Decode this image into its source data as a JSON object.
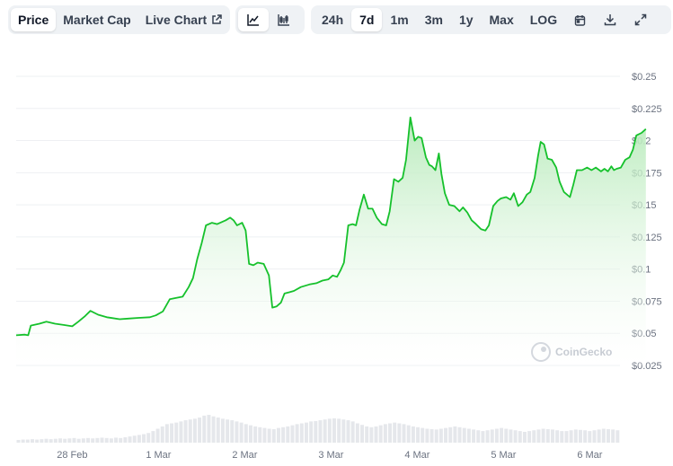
{
  "toolbar": {
    "view_tabs": [
      {
        "label": "Price",
        "active": true
      },
      {
        "label": "Market Cap",
        "active": false
      },
      {
        "label": "Live Chart",
        "active": false
      }
    ],
    "chart_types": [
      {
        "icon": "line-chart-icon",
        "active": true
      },
      {
        "icon": "candlestick-chart-icon",
        "active": false
      }
    ],
    "ranges": [
      {
        "label": "24h",
        "active": false
      },
      {
        "label": "7d",
        "active": true
      },
      {
        "label": "1m",
        "active": false
      },
      {
        "label": "3m",
        "active": false
      },
      {
        "label": "1y",
        "active": false
      },
      {
        "label": "Max",
        "active": false
      },
      {
        "label": "LOG",
        "active": false
      }
    ],
    "actions": [
      "calendar-icon",
      "download-icon",
      "expand-icon"
    ]
  },
  "watermark": "CoinGecko",
  "colors": {
    "line": "#16c12c",
    "fill_top": "#b6eab9",
    "volume": "#e5e7eb",
    "grid": "#eef0f3",
    "active_bg": "#ffffff",
    "segment_bg": "#eff2f5"
  },
  "chart_data": {
    "type": "area",
    "title": "",
    "xlabel": "",
    "ylabel": "",
    "x_range": [
      0,
      7
    ],
    "ylim": [
      0.025,
      0.25
    ],
    "y_ticks": [
      {
        "value": 0.25,
        "label": "$0.25"
      },
      {
        "value": 0.225,
        "label": "$0.225"
      },
      {
        "value": 0.2,
        "label": "$0.2"
      },
      {
        "value": 0.175,
        "label": "$0.175"
      },
      {
        "value": 0.15,
        "label": "$0.15"
      },
      {
        "value": 0.125,
        "label": "$0.125"
      },
      {
        "value": 0.1,
        "label": "$0.1"
      },
      {
        "value": 0.075,
        "label": "$0.075"
      },
      {
        "value": 0.05,
        "label": "$0.05"
      },
      {
        "value": 0.025,
        "label": "$0.025"
      }
    ],
    "x_ticks": [
      {
        "value": 0.65,
        "label": "28 Feb"
      },
      {
        "value": 1.65,
        "label": "1 Mar"
      },
      {
        "value": 2.65,
        "label": "2 Mar"
      },
      {
        "value": 3.65,
        "label": "3 Mar"
      },
      {
        "value": 4.65,
        "label": "4 Mar"
      },
      {
        "value": 5.65,
        "label": "5 Mar"
      },
      {
        "value": 6.65,
        "label": "6 Mar"
      }
    ],
    "grid": true,
    "series": [
      {
        "values": [
          [
            0.0,
            0.0485
          ],
          [
            0.1,
            0.049
          ],
          [
            0.14,
            0.0485
          ],
          [
            0.17,
            0.056
          ],
          [
            0.27,
            0.0575
          ],
          [
            0.35,
            0.059
          ],
          [
            0.45,
            0.0575
          ],
          [
            0.55,
            0.0565
          ],
          [
            0.65,
            0.0555
          ],
          [
            0.72,
            0.059
          ],
          [
            0.8,
            0.0635
          ],
          [
            0.86,
            0.0675
          ],
          [
            0.95,
            0.0645
          ],
          [
            1.05,
            0.0625
          ],
          [
            1.2,
            0.061
          ],
          [
            1.3,
            0.0615
          ],
          [
            1.42,
            0.062
          ],
          [
            1.55,
            0.0625
          ],
          [
            1.62,
            0.064
          ],
          [
            1.7,
            0.067
          ],
          [
            1.78,
            0.0765
          ],
          [
            1.85,
            0.0775
          ],
          [
            1.93,
            0.0785
          ],
          [
            2.0,
            0.086
          ],
          [
            2.05,
            0.093
          ],
          [
            2.1,
            0.108
          ],
          [
            2.15,
            0.12
          ],
          [
            2.2,
            0.134
          ],
          [
            2.27,
            0.136
          ],
          [
            2.33,
            0.135
          ],
          [
            2.43,
            0.138
          ],
          [
            2.48,
            0.14
          ],
          [
            2.52,
            0.138
          ],
          [
            2.56,
            0.134
          ],
          [
            2.62,
            0.136
          ],
          [
            2.66,
            0.13
          ],
          [
            2.7,
            0.104
          ],
          [
            2.75,
            0.103
          ],
          [
            2.8,
            0.105
          ],
          [
            2.87,
            0.104
          ],
          [
            2.93,
            0.095
          ],
          [
            2.97,
            0.07
          ],
          [
            3.02,
            0.071
          ],
          [
            3.07,
            0.074
          ],
          [
            3.11,
            0.081
          ],
          [
            3.17,
            0.082
          ],
          [
            3.22,
            0.083
          ],
          [
            3.3,
            0.086
          ],
          [
            3.4,
            0.088
          ],
          [
            3.48,
            0.089
          ],
          [
            3.55,
            0.091
          ],
          [
            3.62,
            0.092
          ],
          [
            3.67,
            0.095
          ],
          [
            3.72,
            0.094
          ],
          [
            3.76,
            0.099
          ],
          [
            3.8,
            0.105
          ],
          [
            3.85,
            0.134
          ],
          [
            3.9,
            0.135
          ],
          [
            3.94,
            0.134
          ],
          [
            3.98,
            0.146
          ],
          [
            4.03,
            0.158
          ],
          [
            4.08,
            0.147
          ],
          [
            4.13,
            0.147
          ],
          [
            4.18,
            0.14
          ],
          [
            4.24,
            0.135
          ],
          [
            4.29,
            0.134
          ],
          [
            4.33,
            0.145
          ],
          [
            4.38,
            0.17
          ],
          [
            4.43,
            0.168
          ],
          [
            4.48,
            0.171
          ],
          [
            4.52,
            0.185
          ],
          [
            4.57,
            0.218
          ],
          [
            4.62,
            0.2
          ],
          [
            4.66,
            0.203
          ],
          [
            4.7,
            0.202
          ],
          [
            4.75,
            0.187
          ],
          [
            4.79,
            0.181
          ],
          [
            4.82,
            0.18
          ],
          [
            4.86,
            0.177
          ],
          [
            4.9,
            0.19
          ],
          [
            4.93,
            0.174
          ],
          [
            4.97,
            0.159
          ],
          [
            5.02,
            0.15
          ],
          [
            5.08,
            0.149
          ],
          [
            5.14,
            0.145
          ],
          [
            5.18,
            0.148
          ],
          [
            5.23,
            0.144
          ],
          [
            5.28,
            0.138
          ],
          [
            5.33,
            0.135
          ],
          [
            5.39,
            0.131
          ],
          [
            5.44,
            0.13
          ],
          [
            5.48,
            0.134
          ],
          [
            5.53,
            0.149
          ],
          [
            5.58,
            0.153
          ],
          [
            5.62,
            0.155
          ],
          [
            5.68,
            0.156
          ],
          [
            5.73,
            0.154
          ],
          [
            5.77,
            0.159
          ],
          [
            5.82,
            0.149
          ],
          [
            5.87,
            0.152
          ],
          [
            5.92,
            0.158
          ],
          [
            5.96,
            0.16
          ],
          [
            6.01,
            0.171
          ],
          [
            6.05,
            0.188
          ],
          [
            6.08,
            0.199
          ],
          [
            6.12,
            0.197
          ],
          [
            6.16,
            0.186
          ],
          [
            6.21,
            0.185
          ],
          [
            6.26,
            0.179
          ],
          [
            6.3,
            0.168
          ],
          [
            6.35,
            0.16
          ],
          [
            6.42,
            0.156
          ],
          [
            6.46,
            0.166
          ],
          [
            6.5,
            0.177
          ],
          [
            6.56,
            0.177
          ],
          [
            6.62,
            0.179
          ],
          [
            6.67,
            0.177
          ],
          [
            6.72,
            0.179
          ],
          [
            6.78,
            0.176
          ],
          [
            6.82,
            0.178
          ],
          [
            6.86,
            0.176
          ],
          [
            6.9,
            0.18
          ],
          [
            6.93,
            0.177
          ],
          [
            6.96,
            0.178
          ],
          [
            7.01,
            0.179
          ],
          [
            7.06,
            0.185
          ],
          [
            7.11,
            0.187
          ],
          [
            7.15,
            0.193
          ],
          [
            7.19,
            0.204
          ],
          [
            7.25,
            0.206
          ],
          [
            7.3,
            0.209
          ]
        ]
      }
    ],
    "volume": {
      "levels": [
        0.07,
        0.08,
        0.08,
        0.09,
        0.08,
        0.09,
        0.1,
        0.09,
        0.1,
        0.11,
        0.1,
        0.11,
        0.12,
        0.1,
        0.11,
        0.12,
        0.11,
        0.12,
        0.13,
        0.12,
        0.11,
        0.13,
        0.12,
        0.14,
        0.16,
        0.18,
        0.2,
        0.22,
        0.25,
        0.3,
        0.36,
        0.42,
        0.48,
        0.5,
        0.52,
        0.55,
        0.58,
        0.6,
        0.62,
        0.65,
        0.7,
        0.72,
        0.68,
        0.65,
        0.62,
        0.6,
        0.58,
        0.55,
        0.52,
        0.48,
        0.45,
        0.42,
        0.4,
        0.38,
        0.36,
        0.35,
        0.38,
        0.4,
        0.42,
        0.45,
        0.48,
        0.5,
        0.52,
        0.55,
        0.56,
        0.58,
        0.6,
        0.62,
        0.63,
        0.62,
        0.6,
        0.58,
        0.55,
        0.5,
        0.46,
        0.42,
        0.4,
        0.42,
        0.45,
        0.48,
        0.5,
        0.52,
        0.5,
        0.48,
        0.45,
        0.42,
        0.4,
        0.38,
        0.36,
        0.35,
        0.34,
        0.36,
        0.38,
        0.4,
        0.42,
        0.4,
        0.38,
        0.36,
        0.34,
        0.32,
        0.3,
        0.32,
        0.34,
        0.36,
        0.38,
        0.36,
        0.34,
        0.32,
        0.3,
        0.28,
        0.3,
        0.32,
        0.34,
        0.36,
        0.35,
        0.34,
        0.32,
        0.3,
        0.3,
        0.32,
        0.34,
        0.33,
        0.32,
        0.3,
        0.32,
        0.34,
        0.36,
        0.35,
        0.34,
        0.32
      ]
    }
  }
}
